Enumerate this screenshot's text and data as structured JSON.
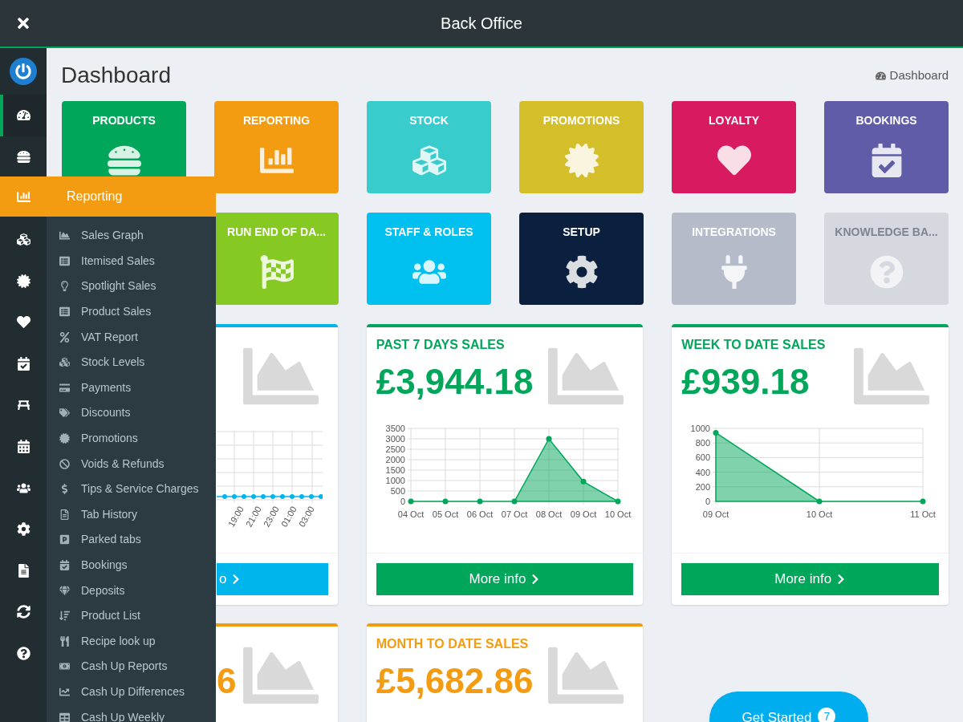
{
  "window": {
    "title": "Back Office"
  },
  "rail": [
    {
      "selected": true
    },
    {
      "selected": false
    },
    {
      "selected": false
    },
    {
      "selected": false
    },
    {
      "selected": false
    },
    {
      "selected": false
    },
    {
      "selected": false
    },
    {
      "selected": false
    },
    {
      "selected": false
    },
    {
      "selected": false
    },
    {
      "selected": false
    },
    {
      "selected": false
    },
    {
      "selected": false
    }
  ],
  "page": {
    "title": "Dashboard",
    "breadcrumb": "Dashboard"
  },
  "tiles": [
    [
      {
        "label": "PRODUCTS",
        "color": "#00a65a",
        "disabled": false
      },
      {
        "label": "REPORTING",
        "color": "#f39c12",
        "disabled": false
      },
      {
        "label": "STOCK",
        "color": "#39cccc",
        "disabled": false
      },
      {
        "label": "PROMOTIONS",
        "color": "#d4bf2a",
        "disabled": false
      },
      {
        "label": "LOYALTY",
        "color": "#d81b60",
        "disabled": false
      },
      {
        "label": "BOOKINGS",
        "color": "#605ca8",
        "disabled": false
      }
    ],
    [
      {
        "label": "RUN END OF DA...",
        "color": "#86c922",
        "disabled": false
      },
      {
        "label": "STAFF & ROLES",
        "color": "#00c0ef",
        "disabled": false
      },
      {
        "label": "SETUP",
        "color": "#0b1f3f",
        "disabled": false
      },
      {
        "label": "INTEGRATIONS",
        "color": "#b5bbc8",
        "disabled": false
      },
      {
        "label": "KNOWLEDGE BA...",
        "color": "#d5d8df",
        "disabled": true
      }
    ]
  ],
  "cards": [
    {
      "kind": "partial",
      "color": "#00b5ec",
      "x_labels": [
        "19:00",
        "21:00",
        "23:00",
        "01:00",
        "03:00"
      ],
      "button": "o"
    },
    {
      "kind": "full",
      "title": "PAST 7 DAYS SALES",
      "amount": "£3,944.18",
      "color": "#00a65a",
      "button": "More info",
      "chart_data": {
        "type": "area",
        "categories": [
          "04 Oct",
          "05 Oct",
          "06 Oct",
          "07 Oct",
          "08 Oct",
          "09 Oct",
          "10 Oct"
        ],
        "series": [
          {
            "color": "#00a65a",
            "values": [
              0,
              0,
              0,
              0,
              3000,
              950,
              0
            ]
          }
        ],
        "ylim": [
          0,
          3500
        ],
        "yticks": [
          0,
          500,
          1000,
          1500,
          2000,
          2500,
          3000,
          3500
        ],
        "grid": true
      }
    },
    {
      "kind": "full",
      "title": "WEEK TO DATE SALES",
      "amount": "£939.18",
      "color": "#00a65a",
      "button": "More info",
      "chart_data": {
        "type": "area",
        "categories": [
          "09 Oct",
          "10 Oct",
          "11 Oct"
        ],
        "series": [
          {
            "color": "#00a65a",
            "values": [
              940,
              0,
              0
            ]
          }
        ],
        "ylim": [
          0,
          1000
        ],
        "yticks": [
          0,
          200,
          400,
          600,
          800,
          1000
        ],
        "grid": true
      }
    },
    {
      "kind": "partial",
      "color": "#f39c12",
      "amount": "6"
    },
    {
      "kind": "full",
      "title": "MONTH TO DATE SALES",
      "amount": "£5,682.86",
      "color": "#f39c12"
    }
  ],
  "flyout": {
    "title": "Reporting",
    "items": [
      "Sales Graph",
      "Itemised Sales",
      "Spotlight Sales",
      "Product Sales",
      "VAT Report",
      "Stock Levels",
      "Payments",
      "Discounts",
      "Promotions",
      "Voids & Refunds",
      "Tips & Service Charges",
      "Tab History",
      "Parked tabs",
      "Bookings",
      "Deposits",
      "Product List",
      "Recipe look up",
      "Cash Up Reports",
      "Cash Up Differences",
      "Cash Up Weekly"
    ]
  },
  "get_started": {
    "label": "Get Started",
    "count": "7"
  }
}
